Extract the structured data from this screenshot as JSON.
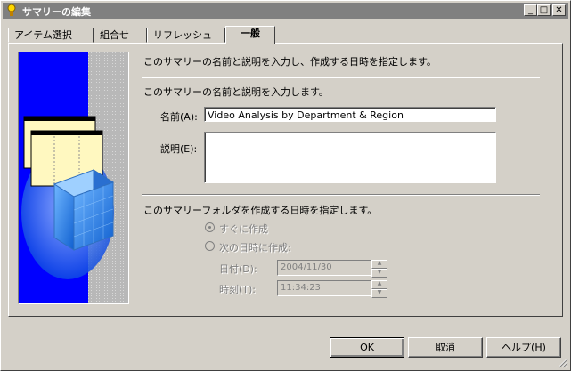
{
  "window": {
    "title": "サマリーの編集",
    "minimize_glyph": "_",
    "maximize_glyph": "□",
    "close_glyph": "✕"
  },
  "tabs": [
    {
      "label": "アイテム選択",
      "active": false
    },
    {
      "label": "組合せ",
      "active": false
    },
    {
      "label": "リフレッシュ",
      "active": false
    },
    {
      "label": "一般",
      "active": true
    }
  ],
  "general": {
    "intro": "このサマリーの名前と説明を入力し、作成する日時を指定します。",
    "name_section_heading": "このサマリーの名前と説明を入力します。",
    "name_label": "名前(A):",
    "name_value": "Video Analysis by Department & Region",
    "description_label": "説明(E):",
    "description_value": "",
    "schedule_heading": "このサマリーフォルダを作成する日時を指定します。",
    "option_now_label": "すぐに作成",
    "option_now_selected": true,
    "option_later_label": "次の日時に作成:",
    "option_later_selected": false,
    "date_label": "日付(D):",
    "date_value": "2004/11/30",
    "time_label": "時刻(T):",
    "time_value": "11:34:23"
  },
  "buttons": {
    "ok": "OK",
    "cancel": "取消",
    "help": "ヘルプ(H)"
  },
  "icons": {
    "app": "summary-wizard-icon",
    "spin_up": "▲",
    "spin_down": "▼"
  },
  "colors": {
    "titlebar": "#808080",
    "face": "#d4d0c8",
    "illustration_blue": "#0000ff"
  }
}
